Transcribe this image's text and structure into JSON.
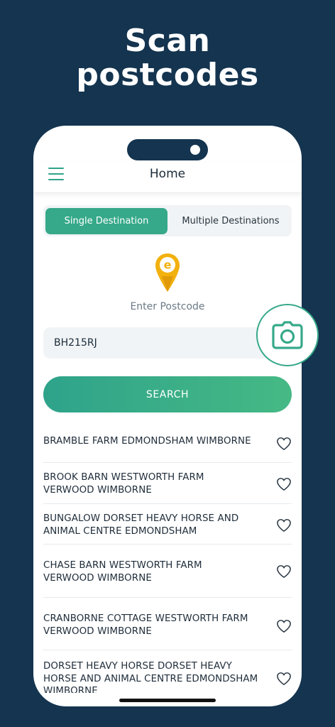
{
  "headline": {
    "line1": "Scan",
    "line2": "postcodes"
  },
  "header": {
    "title": "Home",
    "menu_icon": "hamburger-menu-icon"
  },
  "tabs": {
    "active": "Single Destination",
    "inactive": "Multiple Destinations"
  },
  "postcode": {
    "label": "Enter Postcode",
    "value": "BH215RJ",
    "icon": "location-pin-icon",
    "camera_icon": "camera-icon"
  },
  "search": {
    "label": "SEARCH"
  },
  "results": [
    {
      "line1": "BRAMBLE FARM EDMONDSHAM WIMBORNE",
      "line2": "",
      "line3": ""
    },
    {
      "line1": "BROOK BARN WESTWORTH FARM",
      "line2": "VERWOOD WIMBORNE",
      "line3": ""
    },
    {
      "line1": "BUNGALOW DORSET HEAVY HORSE AND",
      "line2": "ANIMAL CENTRE EDMONDSHAM",
      "line3": ""
    },
    {
      "line1": "CHASE BARN WESTWORTH FARM",
      "line2": "VERWOOD WIMBORNE",
      "line3": ""
    },
    {
      "line1": "CRANBORNE COTTAGE WESTWORTH FARM",
      "line2": "VERWOOD WIMBORNE",
      "line3": ""
    },
    {
      "line1": "DORSET HEAVY HORSE DORSET HEAVY",
      "line2": "HORSE AND ANIMAL CENTRE EDMONDSHAM",
      "line3": "WIMBORNE"
    }
  ],
  "colors": {
    "accent": "#36a98a",
    "background": "#14344f",
    "pin": "#f2b10f"
  }
}
